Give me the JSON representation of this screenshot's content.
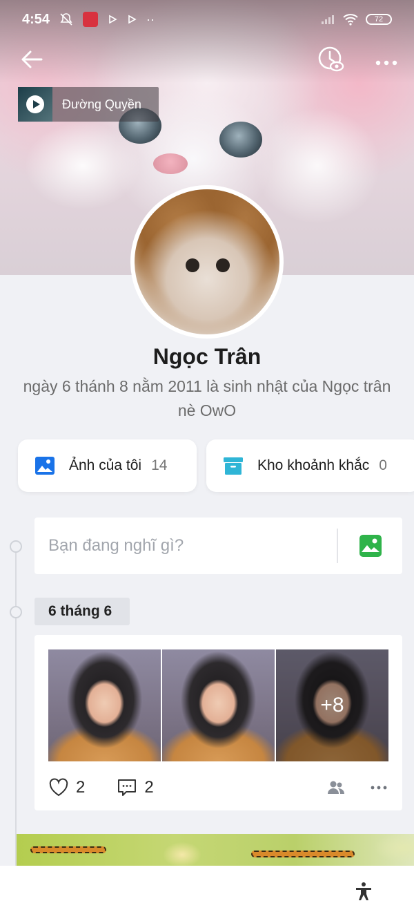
{
  "status_bar": {
    "time": "4:54",
    "battery": "72"
  },
  "music": {
    "title": "Đường Quyền"
  },
  "profile": {
    "name": "Ngọc Trân",
    "bio": "ngày 6 thánh 8 nằm 2011 là sinh nhật của Ngọc trân nè OwO"
  },
  "cards": {
    "photos": {
      "label": "Ảnh của tôi",
      "count": "14"
    },
    "moments": {
      "label": "Kho khoảnh khắc",
      "count": "0"
    }
  },
  "composer": {
    "placeholder": "Bạn đang nghĩ gì?"
  },
  "timeline": {
    "date": "6 tháng 6"
  },
  "post": {
    "more_photos": "+8",
    "likes": "2",
    "comments": "2"
  },
  "colors": {
    "accent_blue": "#1a73e8",
    "moments_cyan": "#2fb5d6",
    "photo_green": "#2fb34a"
  }
}
